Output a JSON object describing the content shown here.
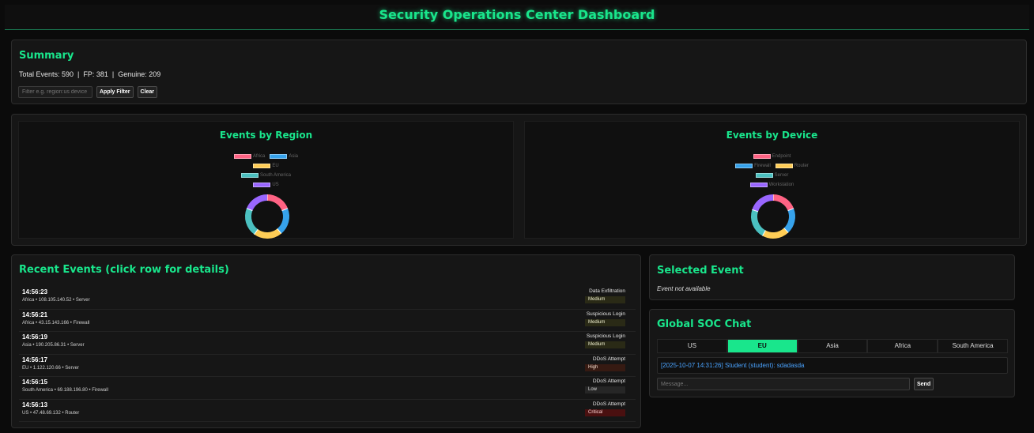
{
  "header": {
    "title": "Security Operations Center Dashboard"
  },
  "summary": {
    "title": "Summary",
    "counts_text": "Total Events: 590  |  FP: 381  |  Genuine: 209",
    "filter_placeholder": "Filter e.g. region:us device",
    "apply_label": "Apply Filter",
    "clear_label": "Clear"
  },
  "charts": {
    "region": {
      "title": "Events by Region",
      "legend": [
        {
          "label": "Africa",
          "color": "#ff6384"
        },
        {
          "label": "Asia",
          "color": "#36a2eb"
        },
        {
          "label": "EU",
          "color": "#ffcd56"
        },
        {
          "label": "South America",
          "color": "#4bc0c0"
        },
        {
          "label": "US",
          "color": "#9966ff"
        }
      ]
    },
    "device": {
      "title": "Events by Device",
      "legend": [
        {
          "label": "Endpoint",
          "color": "#ff6384"
        },
        {
          "label": "Firewall",
          "color": "#36a2eb"
        },
        {
          "label": "Router",
          "color": "#ffcd56"
        },
        {
          "label": "Server",
          "color": "#4bc0c0"
        },
        {
          "label": "Workstation",
          "color": "#9966ff"
        }
      ]
    }
  },
  "chart_data": [
    {
      "type": "pie",
      "title": "Events by Region",
      "categories": [
        "Africa",
        "Asia",
        "EU",
        "South America",
        "US"
      ],
      "values": [
        0.19,
        0.2,
        0.21,
        0.21,
        0.19
      ]
    },
    {
      "type": "pie",
      "title": "Events by Device",
      "categories": [
        "Endpoint",
        "Firewall",
        "Router",
        "Server",
        "Workstation"
      ],
      "values": [
        0.19,
        0.19,
        0.2,
        0.22,
        0.2
      ]
    }
  ],
  "recent": {
    "title": "Recent Events (click row for details)",
    "events": [
      {
        "time": "14:56:23",
        "meta": "Africa • 108.105.140.52 • Server",
        "type": "Data Exfiltration",
        "severity": "Medium"
      },
      {
        "time": "14:56:21",
        "meta": "Africa • 43.15.143.166 • Firewall",
        "type": "Suspicious Login",
        "severity": "Medium"
      },
      {
        "time": "14:56:19",
        "meta": "Asia • 190.205.86.31 • Server",
        "type": "Suspicious Login",
        "severity": "Medium"
      },
      {
        "time": "14:56:17",
        "meta": "EU • 1.122.120.66 • Server",
        "type": "DDoS Attempt",
        "severity": "High"
      },
      {
        "time": "14:56:15",
        "meta": "South America • 69.188.196.80 • Firewall",
        "type": "DDoS Attempt",
        "severity": "Low"
      },
      {
        "time": "14:56:13",
        "meta": "US • 47.48.69.132 • Router",
        "type": "DDoS Attempt",
        "severity": "Critical"
      }
    ]
  },
  "selected": {
    "title": "Selected Event",
    "empty_text": "Event not available"
  },
  "chat": {
    "title": "Global SOC Chat",
    "tabs": [
      "US",
      "EU",
      "Asia",
      "Africa",
      "South America"
    ],
    "active_tab": "EU",
    "messages": [
      "[2025-10-07 14:31:26] Student (student): sdadasda"
    ],
    "input_placeholder": "Message...",
    "send_label": "Send"
  }
}
